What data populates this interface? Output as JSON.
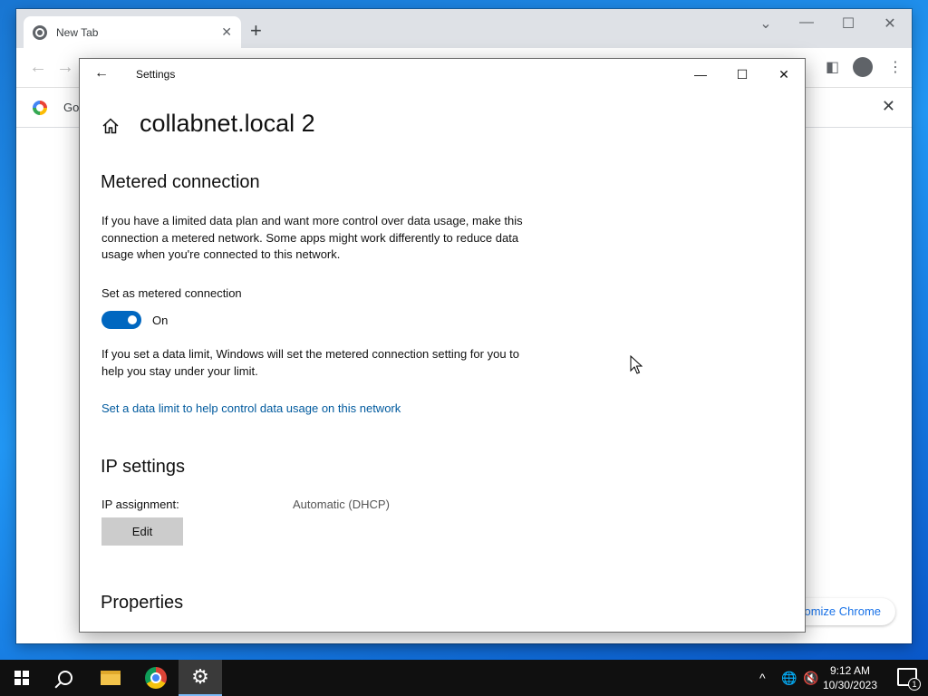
{
  "chrome": {
    "tab_title": "New Tab",
    "tab_close": "✕",
    "new_tab": "+",
    "bookmark_text": "Go",
    "bookmark_close": "✕",
    "customize_label": "stomize Chrome"
  },
  "settings": {
    "window_title": "Settings",
    "page_title": "collabnet.local 2",
    "metered": {
      "heading": "Metered connection",
      "description": "If you have a limited data plan and want more control over data usage, make this connection a metered network. Some apps might work differently to reduce data usage when you're connected to this network.",
      "toggle_label": "Set as metered connection",
      "toggle_state": "On",
      "limit_note": "If you set a data limit, Windows will set the metered connection setting for you to help you stay under your limit.",
      "link": "Set a data limit to help control data usage on this network"
    },
    "ip": {
      "heading": "IP settings",
      "assignment_label": "IP assignment:",
      "assignment_value": "Automatic (DHCP)",
      "edit_button": "Edit"
    },
    "properties": {
      "heading": "Properties"
    }
  },
  "taskbar": {
    "time": "9:12 AM",
    "date": "10/30/2023",
    "notification_count": "1"
  }
}
